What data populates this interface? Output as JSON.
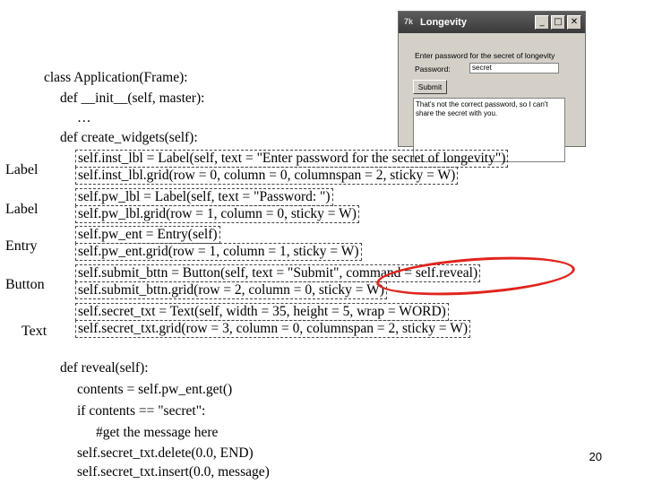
{
  "window": {
    "title": "Longevity",
    "icon_name": "tk-feather-icon",
    "buttons": {
      "minimize": "_",
      "maximize": "□",
      "close": "✕"
    },
    "instruction_label": "Enter password for the secret of longevity",
    "password_label": "Password:",
    "password_value": "secret",
    "submit_label": "Submit",
    "secret_text": "That's not the correct password, so I can't share the secret with you."
  },
  "code": {
    "l1": "class Application(Frame):",
    "l2": "def __init__(self, master):",
    "l3": "…",
    "l4": "def create_widgets(self):",
    "l5": "self.inst_lbl = Label(self, text = \"Enter password for the secret of longevity\")",
    "l6": "self.inst_lbl.grid(row = 0, column = 0, columnspan = 2, sticky = W)",
    "l7": "self.pw_lbl = Label(self, text = \"Password: \")",
    "l8": "self.pw_lbl.grid(row = 1, column = 0, sticky = W)",
    "l9": "self.pw_ent = Entry(self)",
    "l10": "self.pw_ent.grid(row = 1, column = 1, sticky = W)",
    "l11": "self.submit_bttn = Button(self, text = \"Submit\", command = self.reveal)",
    "l12": "self.submit_bttn.grid(row = 2, column = 0, sticky = W)",
    "l13": "self.secret_txt = Text(self, width = 35, height = 5, wrap = WORD)",
    "l14": "self.secret_txt.grid(row = 3, column = 0, columnspan = 2, sticky = W)",
    "r1": "def reveal(self):",
    "r2": "contents = self.pw_ent.get()",
    "r3": "if contents == \"secret\":",
    "r4": "#get the message here",
    "r5": "self.secret_txt.delete(0.0, END)",
    "r6": "self.secret_txt.insert(0.0, message)"
  },
  "side_labels": {
    "label1": "Label",
    "label2": "Label",
    "entry": "Entry",
    "button": "Button",
    "text": "Text"
  },
  "page_number": "20",
  "colors": {
    "highlight_oval": "#e0241d",
    "titlebar": "#4a4a4a"
  }
}
